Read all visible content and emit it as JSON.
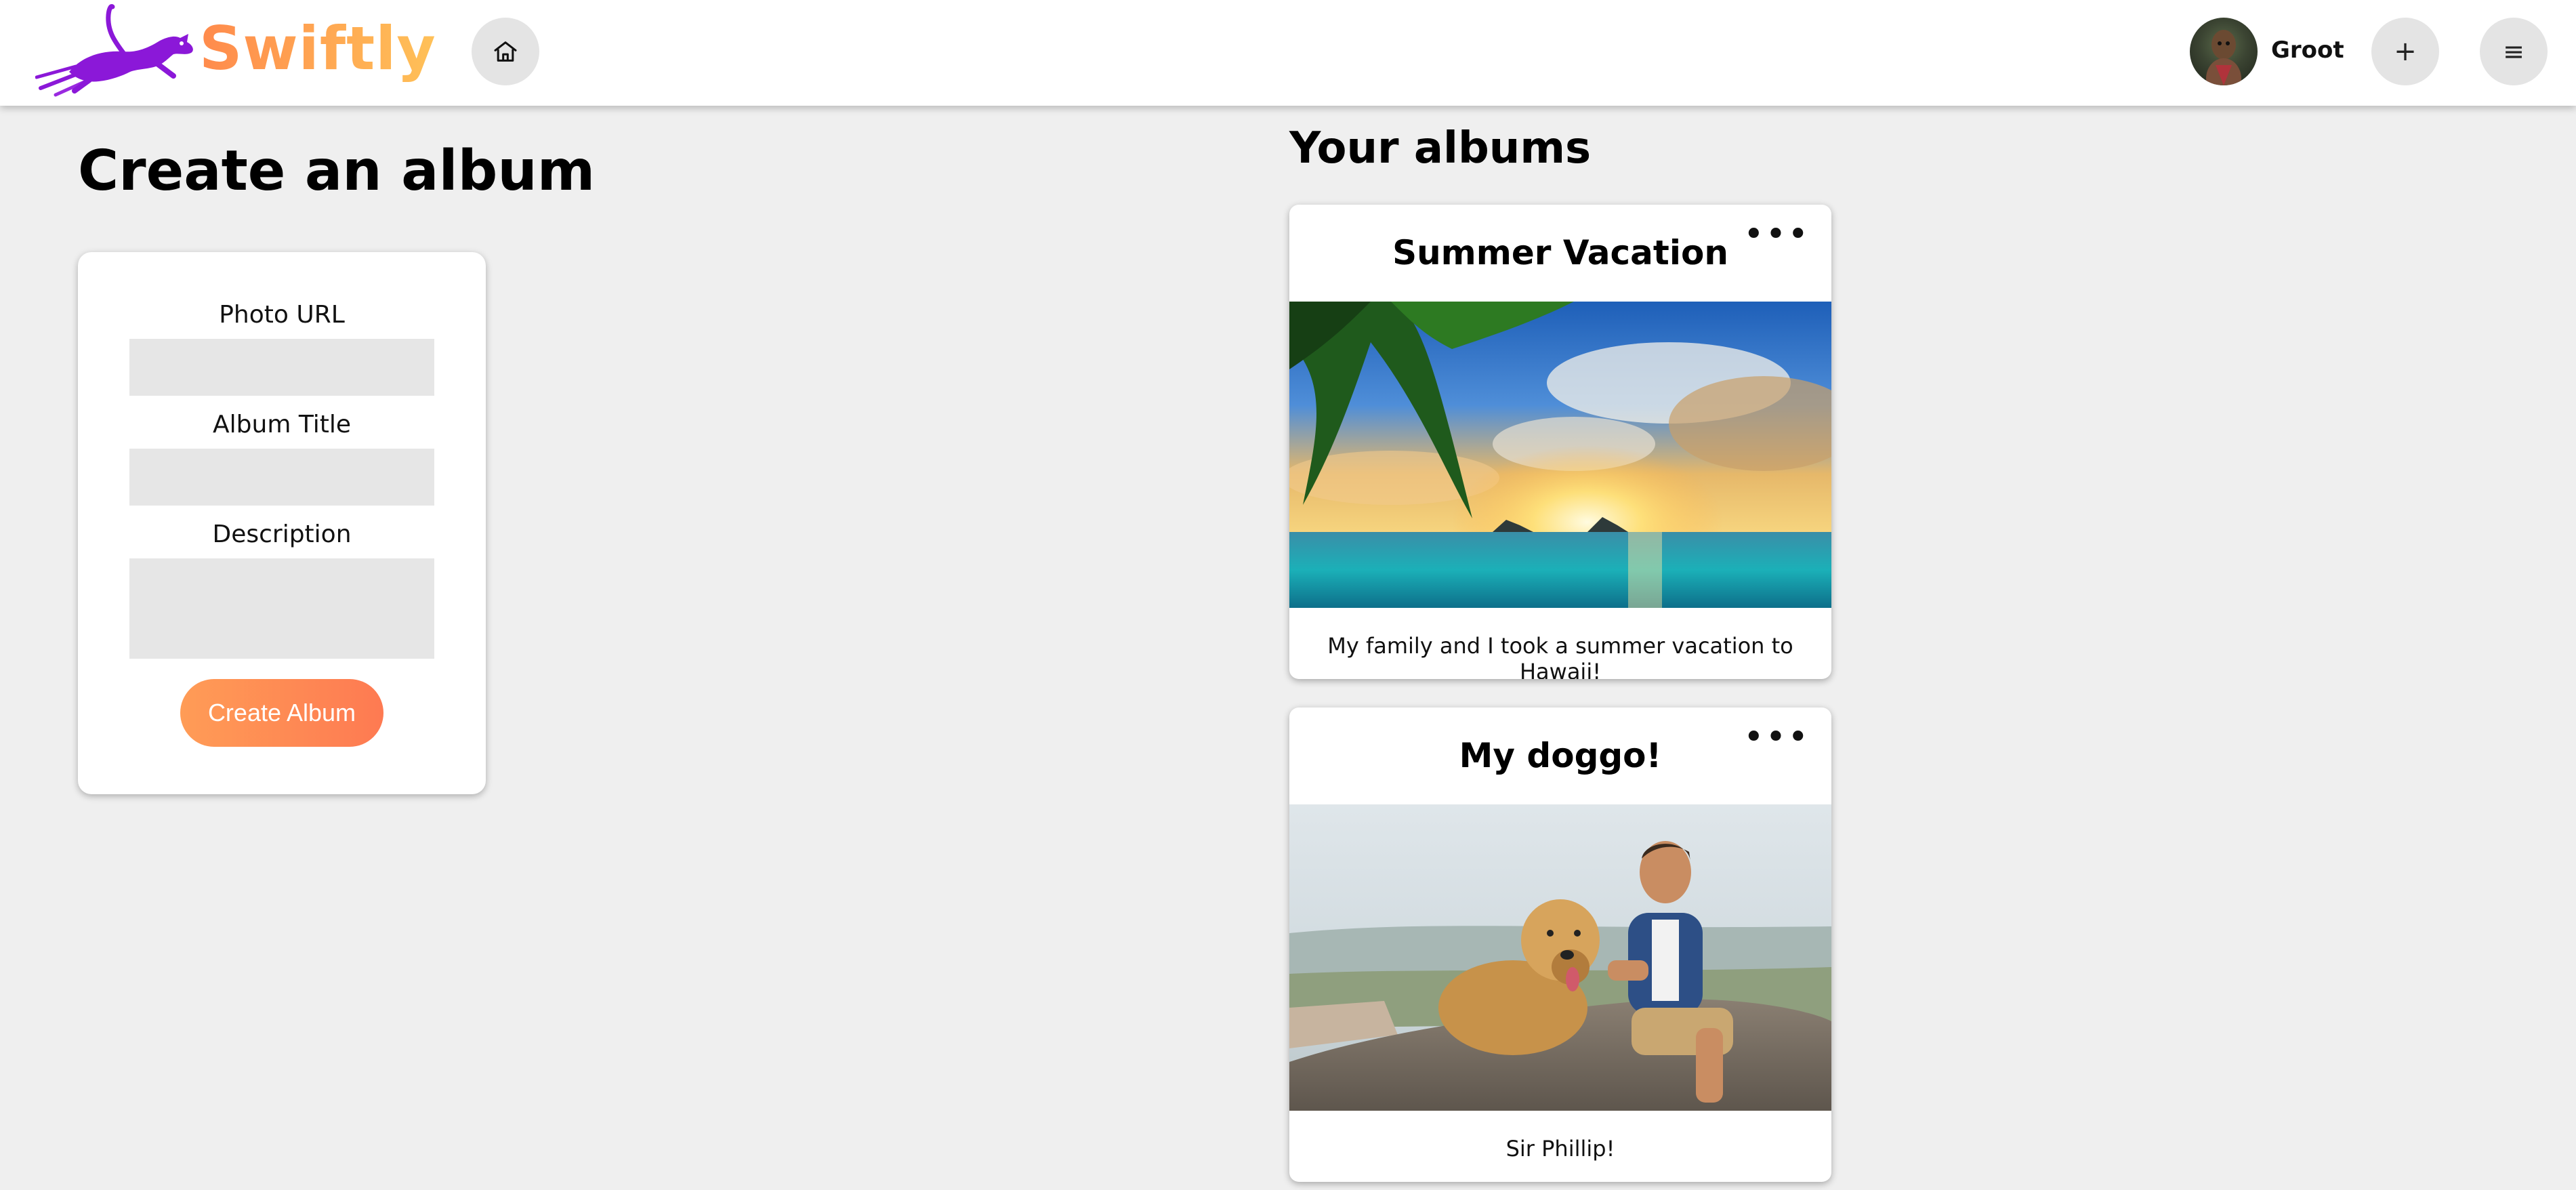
{
  "app": {
    "brand": "Swiftly",
    "brand_colors": [
      "#ff8a4c",
      "#ffc158"
    ],
    "logo_color": "#8b18d8"
  },
  "header": {
    "home_icon": "home-icon",
    "user": {
      "name": "Groot"
    },
    "add_icon": "plus-icon",
    "menu_icon": "hamburger-menu-icon"
  },
  "create": {
    "title": "Create an album",
    "fields": {
      "photo_url_label": "Photo URL",
      "photo_url_value": "",
      "album_title_label": "Album Title",
      "album_title_value": "",
      "description_label": "Description",
      "description_value": ""
    },
    "button_label": "Create Album",
    "button_color": "#fe8a55"
  },
  "albums": {
    "title": "Your albums",
    "items": [
      {
        "title": "Summer Vacation",
        "more_icon": "more-horizontal-icon",
        "photo": "tropical-beach-sunset-with-palm-tree",
        "description": "My family and I took a summer vacation to Hawaii!"
      },
      {
        "title": "My doggo!",
        "more_icon": "more-horizontal-icon",
        "photo": "man-with-golden-retriever-on-rock",
        "description": "Sir Phillip!"
      }
    ]
  }
}
